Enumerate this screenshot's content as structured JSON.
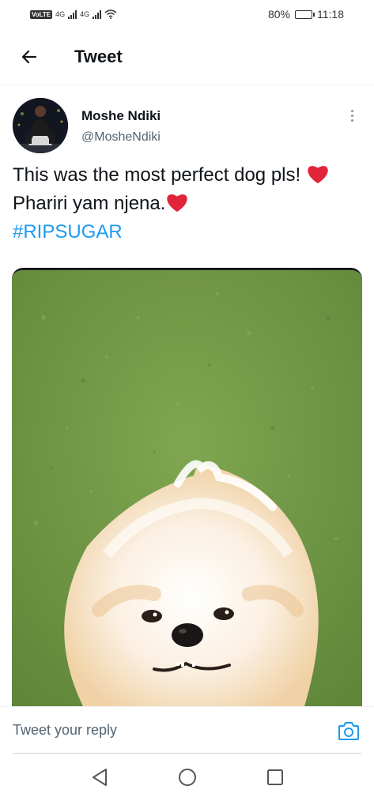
{
  "status_bar": {
    "network_label": "VoLTE",
    "signal_1_label": "4G",
    "signal_2_label": "4G",
    "battery": "80%",
    "battery_level": 0.8,
    "time": "11:18"
  },
  "header": {
    "title": "Tweet",
    "back_icon": "arrow-left-icon"
  },
  "tweet": {
    "author_name": "Moshe Ndiki",
    "author_handle": "@MosheNdiki",
    "text_part_1": "This was the most perfect dog pls! ",
    "text_part_2": "Phariri yam njena.",
    "hashtag": "#RIPSUGAR",
    "heart_icon": "red-heart-emoji",
    "more_icon": "more-vertical-icon"
  },
  "reply": {
    "placeholder": "Tweet your reply",
    "camera_icon": "camera-icon"
  },
  "nav": {
    "back_icon": "triangle-back-icon",
    "home_icon": "circle-home-icon",
    "recents_icon": "square-recents-icon"
  },
  "colors": {
    "accent": "#1d9bf0",
    "text_primary": "#0f1419",
    "text_secondary": "#536471",
    "heart": "#e0243a"
  }
}
